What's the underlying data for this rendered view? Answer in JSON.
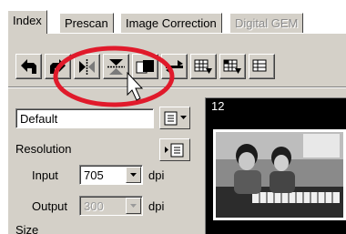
{
  "tabs": [
    {
      "label": "Index",
      "state": "active"
    },
    {
      "label": "Prescan",
      "state": "normal"
    },
    {
      "label": "Image Correction",
      "state": "normal"
    },
    {
      "label": "Digital GEM",
      "state": "disabled"
    }
  ],
  "toolbar": {
    "buttons": [
      {
        "name": "rotate-left-icon"
      },
      {
        "name": "rotate-right-icon"
      },
      {
        "name": "flip-horizontal-icon"
      },
      {
        "name": "flip-vertical-icon"
      },
      {
        "name": "frame-invert-icon"
      },
      {
        "name": "swap-icon"
      },
      {
        "name": "grid-select-icon"
      },
      {
        "name": "grid-select-alt-icon"
      },
      {
        "name": "grid-select-more-icon"
      }
    ]
  },
  "settings": {
    "preset_value": "Default",
    "resolution_label": "Resolution",
    "input_label": "Input",
    "input_value": "705",
    "output_label": "Output",
    "output_value": "300",
    "unit_label": "dpi",
    "size_label": "Size"
  },
  "thumbnail": {
    "frame_number": "12"
  },
  "colors": {
    "callout": "#e01a2b",
    "panel": "#d4d0c8"
  }
}
